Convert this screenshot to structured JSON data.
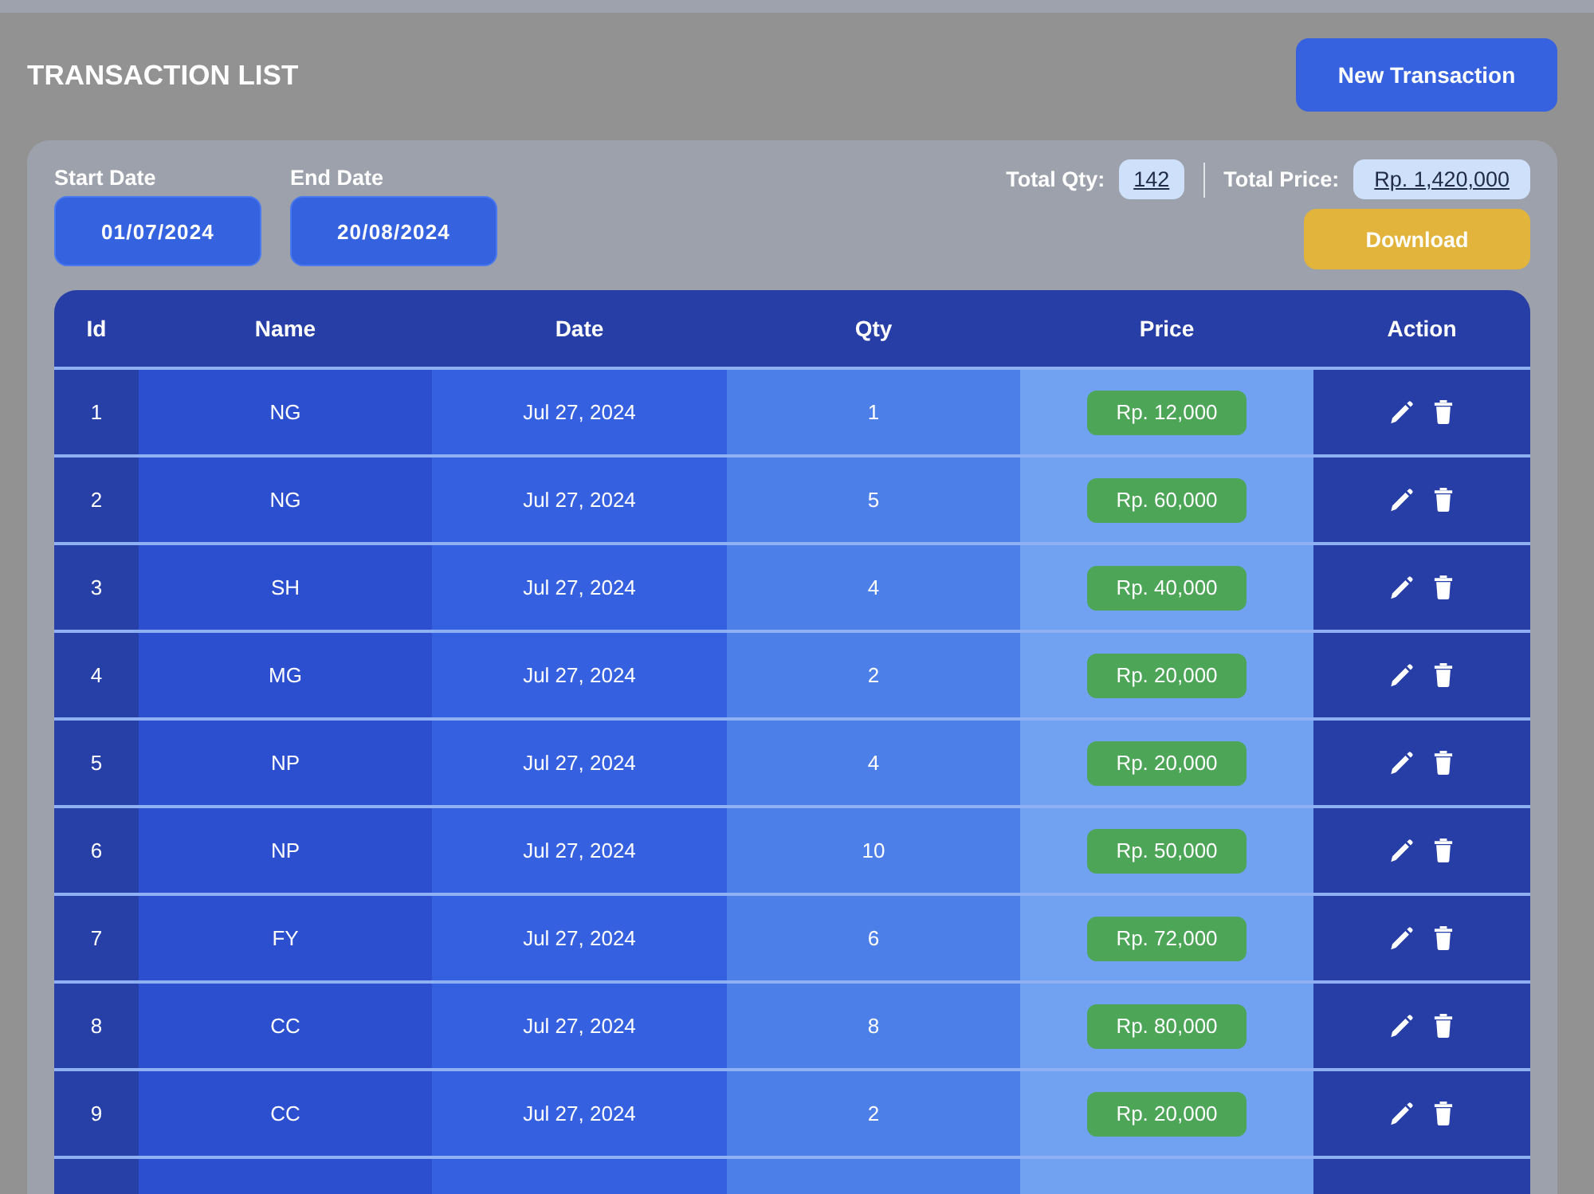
{
  "header": {
    "title": "TRANSACTION LIST",
    "new_button": "New Transaction"
  },
  "filters": [
    {
      "label": "Start Date",
      "value": "01/07/2024"
    },
    {
      "label": "End Date",
      "value": "20/08/2024"
    }
  ],
  "totals": {
    "qty_label": "Total Qty:",
    "qty": "142",
    "price_label": "Total Price:",
    "price": "Rp. 1,420,000"
  },
  "download_button": "Download",
  "table": {
    "columns": [
      "Id",
      "Name",
      "Date",
      "Qty",
      "Price",
      "Action"
    ],
    "rows": [
      {
        "id": "1",
        "name": "NG",
        "date": "Jul 27, 2024",
        "qty": "1",
        "price": "Rp. 12,000"
      },
      {
        "id": "2",
        "name": "NG",
        "date": "Jul 27, 2024",
        "qty": "5",
        "price": "Rp. 60,000"
      },
      {
        "id": "3",
        "name": "SH",
        "date": "Jul 27, 2024",
        "qty": "4",
        "price": "Rp. 40,000"
      },
      {
        "id": "4",
        "name": "MG",
        "date": "Jul 27, 2024",
        "qty": "2",
        "price": "Rp. 20,000"
      },
      {
        "id": "5",
        "name": "NP",
        "date": "Jul 27, 2024",
        "qty": "4",
        "price": "Rp. 20,000"
      },
      {
        "id": "6",
        "name": "NP",
        "date": "Jul 27, 2024",
        "qty": "10",
        "price": "Rp. 50,000"
      },
      {
        "id": "7",
        "name": "FY",
        "date": "Jul 27, 2024",
        "qty": "6",
        "price": "Rp. 72,000"
      },
      {
        "id": "8",
        "name": "CC",
        "date": "Jul 27, 2024",
        "qty": "8",
        "price": "Rp. 80,000"
      },
      {
        "id": "9",
        "name": "CC",
        "date": "Jul 27, 2024",
        "qty": "2",
        "price": "Rp. 20,000"
      }
    ]
  }
}
